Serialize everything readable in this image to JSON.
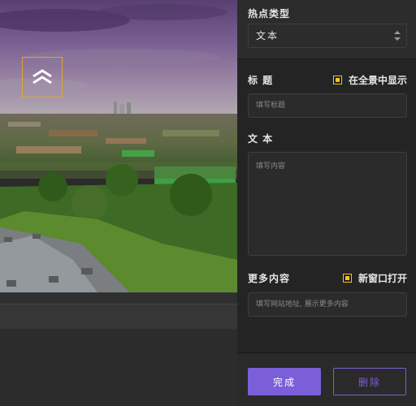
{
  "panel": {
    "hotspot_type_label": "热点类型",
    "hotspot_type_value": "文本",
    "title_label": "标 题",
    "show_in_panorama_label": "在全景中显示",
    "title_placeholder": "填写标题",
    "text_label": "文 本",
    "text_placeholder": "填写内容",
    "more_content_label": "更多内容",
    "new_window_label": "新窗口打开",
    "url_placeholder": "填写网站地址, 展示更多内容",
    "done_label": "完成",
    "delete_label": "删除"
  },
  "colors": {
    "accent": "#7b5fd8",
    "checkbox": "#f5c518",
    "hotspot_border": "#e0a82a"
  },
  "icons": {
    "hotspot": "double-chevron-up-icon",
    "select": "updown-arrows-icon"
  }
}
